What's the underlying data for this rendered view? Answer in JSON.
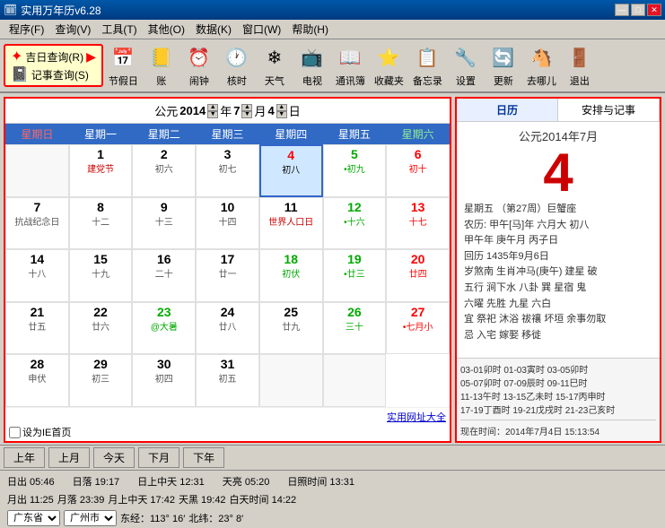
{
  "titlebar": {
    "title": "实用万年历v6.28",
    "min": "—",
    "max": "□",
    "close": "✕"
  },
  "menubar": {
    "items": [
      "程序(F)",
      "查询(V)",
      "工具(T)",
      "其他(O)",
      "数据(K)",
      "窗口(W)",
      "帮助(H)"
    ]
  },
  "toolbar": {
    "query_box": {
      "line1": "吉日查询(R)",
      "line2": "记事查询(S)"
    },
    "buttons": [
      {
        "label": "节假日",
        "icon": "📅"
      },
      {
        "label": "账",
        "icon": "📒"
      },
      {
        "label": "闹钟",
        "icon": "⏰"
      },
      {
        "label": "核时",
        "icon": "🕐"
      },
      {
        "label": "天气",
        "icon": "❄"
      },
      {
        "label": "电视",
        "icon": "📺"
      },
      {
        "label": "通讯簿",
        "icon": "📖"
      },
      {
        "label": "收藏夹",
        "icon": "⭐"
      },
      {
        "label": "备忘录",
        "icon": "📋"
      },
      {
        "label": "设置",
        "icon": "🔧"
      },
      {
        "label": "更新",
        "icon": "🔄"
      },
      {
        "label": "去哪儿",
        "icon": "🐴"
      },
      {
        "label": "退出",
        "icon": "🚪"
      }
    ]
  },
  "calendar": {
    "year": "2014",
    "month": "7",
    "day": "4",
    "title_prefix": "公元",
    "title_year_suffix": "年",
    "title_month_suffix": "月",
    "title_day_suffix": "日",
    "weekdays": [
      "星期日",
      "星期一",
      "星期二",
      "星期三",
      "星期四",
      "星期五",
      "星期六"
    ],
    "cells": [
      {
        "day": "",
        "sub": "",
        "type": "empty"
      },
      {
        "day": "1",
        "sub": "建党节",
        "type": "holiday",
        "color": "black"
      },
      {
        "day": "2",
        "sub": "初六",
        "type": "normal"
      },
      {
        "day": "3",
        "sub": "初七",
        "type": "normal"
      },
      {
        "day": "4",
        "sub": "初八",
        "type": "selected",
        "color": "red"
      },
      {
        "day": "5",
        "sub": "•初九",
        "type": "saturday"
      },
      {
        "day": "6",
        "sub": "初十",
        "type": "sunday",
        "color": "red"
      },
      {
        "day": "7",
        "sub": "抗战纪念日",
        "type": "normal"
      },
      {
        "day": "8",
        "sub": "十二",
        "type": "normal"
      },
      {
        "day": "9",
        "sub": "十三",
        "type": "normal"
      },
      {
        "day": "10",
        "sub": "十四",
        "type": "normal"
      },
      {
        "day": "11",
        "sub": "世界人口日",
        "type": "holiday"
      },
      {
        "day": "12",
        "sub": "•十六",
        "type": "saturday"
      },
      {
        "day": "13",
        "sub": "十七",
        "type": "sunday",
        "color": "red"
      },
      {
        "day": "14",
        "sub": "十八",
        "type": "normal"
      },
      {
        "day": "15",
        "sub": "十九",
        "type": "normal"
      },
      {
        "day": "16",
        "sub": "二十",
        "type": "normal"
      },
      {
        "day": "17",
        "sub": "廿一",
        "type": "normal"
      },
      {
        "day": "18",
        "sub": "初伏",
        "type": "green"
      },
      {
        "day": "19",
        "sub": "•廿三",
        "type": "saturday"
      },
      {
        "day": "20",
        "sub": "廿四",
        "type": "sunday",
        "color": "red"
      },
      {
        "day": "21",
        "sub": "廿五",
        "type": "normal"
      },
      {
        "day": "22",
        "sub": "廿六",
        "type": "normal"
      },
      {
        "day": "23",
        "sub": "@大暑",
        "type": "green"
      },
      {
        "day": "24",
        "sub": "廿八",
        "type": "normal"
      },
      {
        "day": "25",
        "sub": "廿九",
        "type": "normal"
      },
      {
        "day": "26",
        "sub": "三十",
        "type": "saturday"
      },
      {
        "day": "27",
        "sub": "•七月小",
        "type": "sunday",
        "color": "red"
      },
      {
        "day": "28",
        "sub": "申伏",
        "type": "normal"
      },
      {
        "day": "29",
        "sub": "初三",
        "type": "normal"
      },
      {
        "day": "30",
        "sub": "初四",
        "type": "normal"
      },
      {
        "day": "31",
        "sub": "初五",
        "type": "normal"
      },
      {
        "day": "",
        "sub": "",
        "type": "empty"
      },
      {
        "day": "",
        "sub": "",
        "type": "empty"
      }
    ],
    "footer_link": "实用网址大全",
    "footer_checkbox": "设为IE首页"
  },
  "right_panel": {
    "tabs": [
      "日历",
      "安排与记事"
    ],
    "date_header": "公元2014年7月",
    "big_day": "4",
    "lines": [
      "星期五  （第27周）巨蟹座",
      "农历: 甲午[马]年  六月大  初八",
      "甲午年 庚午月 丙子日",
      "回历 1435年9月6日",
      "",
      "岁煞南 生肖冲马(庚午)  建星 破",
      "五行 涧下水  八卦 巽  星宿 鬼",
      "六曜 先胜  九星 六白",
      "宜 祭祀  沐浴  祓禳  坏垣 余事勿取",
      "忌 入宅  嫁娶  移徙"
    ],
    "bottom_times": [
      "03-01卯时 01-03寅时 03-05卯时",
      "05-07卯时 07-09辰时 09-11巳时",
      "11-13午时 13-15乙未时 15-17丙申时",
      "17-19丁酉时 19-21戊戌时 21-23己亥时"
    ],
    "current_date": "现在时间：2014年7月4日  15:13:54"
  },
  "bottom_nav": {
    "buttons": [
      "上年",
      "上月",
      "今天",
      "下月",
      "下年"
    ]
  },
  "status": {
    "sunrise": "日出 05:46",
    "sunset": "日落 19:17",
    "noon_sun": "日上中天 12:31",
    "tianmu": "天亮 05:20",
    "sunshine": "日照时间 13:31",
    "moonrise": "月出 11:25",
    "moonset": "月落 23:39",
    "noon_moon": "月上中天 17:42",
    "tianhei": "天黑 19:42",
    "moonlight": "白天时间 14:22",
    "province": "广东省",
    "city": "广州市",
    "longitude": "东经：113° 16′",
    "latitude": "北纬：23° 8′"
  }
}
